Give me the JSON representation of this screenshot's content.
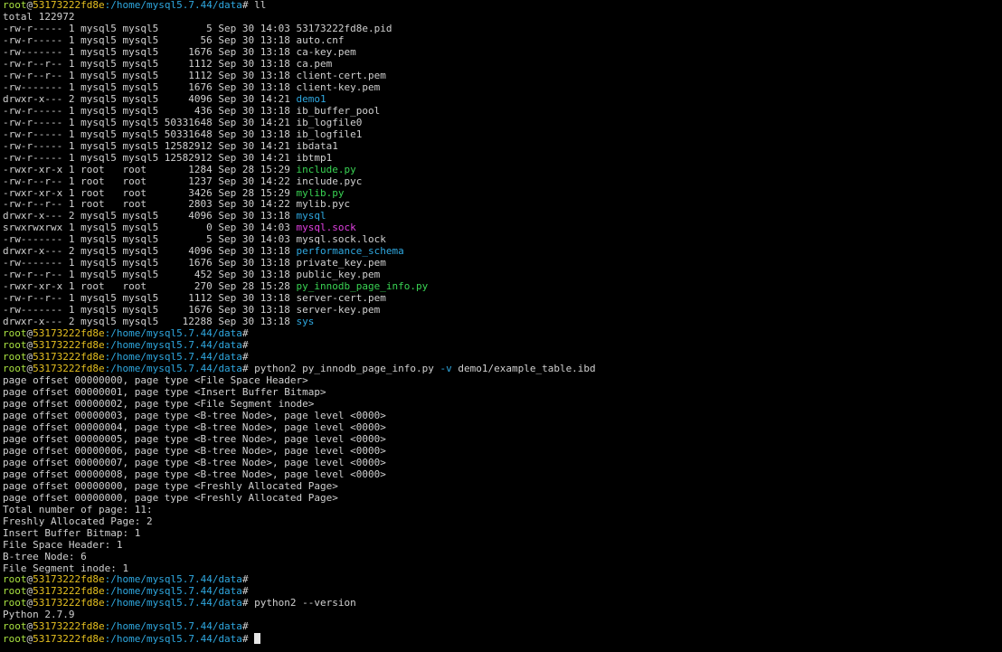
{
  "colors": {
    "background": "#000000",
    "default": "#d0d0d0",
    "prompt_user": "#a8e040",
    "prompt_at": "#d0d0d0",
    "prompt_host": "#e5c020",
    "prompt_path": "#2fa8e0",
    "directory": "#2fa8e0",
    "executable": "#39d353",
    "socket": "#e040e0",
    "option": "#2fa8e0",
    "cursor": "#e6e6e6"
  },
  "terminal": {
    "lines": [
      [
        {
          "t": "root",
          "c": "prompt_user"
        },
        {
          "t": "@",
          "c": "prompt_at"
        },
        {
          "t": "53173222fd8e",
          "c": "prompt_host"
        },
        {
          "t": ":/home/mysql5.7.44/data",
          "c": "prompt_path"
        },
        {
          "t": "# ll",
          "c": "default"
        }
      ],
      [
        {
          "t": "total 122972",
          "c": "default"
        }
      ],
      [
        {
          "t": "-rw-r----- 1 mysql5 mysql5        5 Sep 30 14:03 53173222fd8e.pid",
          "c": "default"
        }
      ],
      [
        {
          "t": "-rw-r----- 1 mysql5 mysql5       56 Sep 30 13:18 auto.cnf",
          "c": "default"
        }
      ],
      [
        {
          "t": "-rw------- 1 mysql5 mysql5     1676 Sep 30 13:18 ca-key.pem",
          "c": "default"
        }
      ],
      [
        {
          "t": "-rw-r--r-- 1 mysql5 mysql5     1112 Sep 30 13:18 ca.pem",
          "c": "default"
        }
      ],
      [
        {
          "t": "-rw-r--r-- 1 mysql5 mysql5     1112 Sep 30 13:18 client-cert.pem",
          "c": "default"
        }
      ],
      [
        {
          "t": "-rw------- 1 mysql5 mysql5     1676 Sep 30 13:18 client-key.pem",
          "c": "default"
        }
      ],
      [
        {
          "t": "drwxr-x--- 2 mysql5 mysql5     4096 Sep 30 14:21 ",
          "c": "default"
        },
        {
          "t": "demo1",
          "c": "directory"
        }
      ],
      [
        {
          "t": "-rw-r----- 1 mysql5 mysql5      436 Sep 30 13:18 ib_buffer_pool",
          "c": "default"
        }
      ],
      [
        {
          "t": "-rw-r----- 1 mysql5 mysql5 50331648 Sep 30 14:21 ib_logfile0",
          "c": "default"
        }
      ],
      [
        {
          "t": "-rw-r----- 1 mysql5 mysql5 50331648 Sep 30 13:18 ib_logfile1",
          "c": "default"
        }
      ],
      [
        {
          "t": "-rw-r----- 1 mysql5 mysql5 12582912 Sep 30 14:21 ibdata1",
          "c": "default"
        }
      ],
      [
        {
          "t": "-rw-r----- 1 mysql5 mysql5 12582912 Sep 30 14:21 ibtmp1",
          "c": "default"
        }
      ],
      [
        {
          "t": "-rwxr-xr-x 1 root   root       1284 Sep 28 15:29 ",
          "c": "default"
        },
        {
          "t": "include.py",
          "c": "executable"
        }
      ],
      [
        {
          "t": "-rw-r--r-- 1 root   root       1237 Sep 30 14:22 include.pyc",
          "c": "default"
        }
      ],
      [
        {
          "t": "-rwxr-xr-x 1 root   root       3426 Sep 28 15:29 ",
          "c": "default"
        },
        {
          "t": "mylib.py",
          "c": "executable"
        }
      ],
      [
        {
          "t": "-rw-r--r-- 1 root   root       2803 Sep 30 14:22 mylib.pyc",
          "c": "default"
        }
      ],
      [
        {
          "t": "drwxr-x--- 2 mysql5 mysql5     4096 Sep 30 13:18 ",
          "c": "default"
        },
        {
          "t": "mysql",
          "c": "directory"
        }
      ],
      [
        {
          "t": "srwxrwxrwx 1 mysql5 mysql5        0 Sep 30 14:03 ",
          "c": "default"
        },
        {
          "t": "mysql.sock",
          "c": "socket"
        }
      ],
      [
        {
          "t": "-rw------- 1 mysql5 mysql5        5 Sep 30 14:03 mysql.sock.lock",
          "c": "default"
        }
      ],
      [
        {
          "t": "drwxr-x--- 2 mysql5 mysql5     4096 Sep 30 13:18 ",
          "c": "default"
        },
        {
          "t": "performance_schema",
          "c": "directory"
        }
      ],
      [
        {
          "t": "-rw------- 1 mysql5 mysql5     1676 Sep 30 13:18 private_key.pem",
          "c": "default"
        }
      ],
      [
        {
          "t": "-rw-r--r-- 1 mysql5 mysql5      452 Sep 30 13:18 public_key.pem",
          "c": "default"
        }
      ],
      [
        {
          "t": "-rwxr-xr-x 1 root   root        270 Sep 28 15:28 ",
          "c": "default"
        },
        {
          "t": "py_innodb_page_info.py",
          "c": "executable"
        }
      ],
      [
        {
          "t": "-rw-r--r-- 1 mysql5 mysql5     1112 Sep 30 13:18 server-cert.pem",
          "c": "default"
        }
      ],
      [
        {
          "t": "-rw------- 1 mysql5 mysql5     1676 Sep 30 13:18 server-key.pem",
          "c": "default"
        }
      ],
      [
        {
          "t": "drwxr-x--- 2 mysql5 mysql5    12288 Sep 30 13:18 ",
          "c": "default"
        },
        {
          "t": "sys",
          "c": "directory"
        }
      ],
      [
        {
          "t": "root",
          "c": "prompt_user"
        },
        {
          "t": "@",
          "c": "prompt_at"
        },
        {
          "t": "53173222fd8e",
          "c": "prompt_host"
        },
        {
          "t": ":/home/mysql5.7.44/data",
          "c": "prompt_path"
        },
        {
          "t": "#",
          "c": "default"
        }
      ],
      [
        {
          "t": "root",
          "c": "prompt_user"
        },
        {
          "t": "@",
          "c": "prompt_at"
        },
        {
          "t": "53173222fd8e",
          "c": "prompt_host"
        },
        {
          "t": ":/home/mysql5.7.44/data",
          "c": "prompt_path"
        },
        {
          "t": "#",
          "c": "default"
        }
      ],
      [
        {
          "t": "root",
          "c": "prompt_user"
        },
        {
          "t": "@",
          "c": "prompt_at"
        },
        {
          "t": "53173222fd8e",
          "c": "prompt_host"
        },
        {
          "t": ":/home/mysql5.7.44/data",
          "c": "prompt_path"
        },
        {
          "t": "#",
          "c": "default"
        }
      ],
      [
        {
          "t": "root",
          "c": "prompt_user"
        },
        {
          "t": "@",
          "c": "prompt_at"
        },
        {
          "t": "53173222fd8e",
          "c": "prompt_host"
        },
        {
          "t": ":/home/mysql5.7.44/data",
          "c": "prompt_path"
        },
        {
          "t": "# python2 py_innodb_page_info.py ",
          "c": "default"
        },
        {
          "t": "-v",
          "c": "option"
        },
        {
          "t": " demo1/example_table.ibd",
          "c": "default"
        }
      ],
      [
        {
          "t": "page offset 00000000, page type <File Space Header>",
          "c": "default"
        }
      ],
      [
        {
          "t": "page offset 00000001, page type <Insert Buffer Bitmap>",
          "c": "default"
        }
      ],
      [
        {
          "t": "page offset 00000002, page type <File Segment inode>",
          "c": "default"
        }
      ],
      [
        {
          "t": "page offset 00000003, page type <B-tree Node>, page level <0000>",
          "c": "default"
        }
      ],
      [
        {
          "t": "page offset 00000004, page type <B-tree Node>, page level <0000>",
          "c": "default"
        }
      ],
      [
        {
          "t": "page offset 00000005, page type <B-tree Node>, page level <0000>",
          "c": "default"
        }
      ],
      [
        {
          "t": "page offset 00000006, page type <B-tree Node>, page level <0000>",
          "c": "default"
        }
      ],
      [
        {
          "t": "page offset 00000007, page type <B-tree Node>, page level <0000>",
          "c": "default"
        }
      ],
      [
        {
          "t": "page offset 00000008, page type <B-tree Node>, page level <0000>",
          "c": "default"
        }
      ],
      [
        {
          "t": "page offset 00000000, page type <Freshly Allocated Page>",
          "c": "default"
        }
      ],
      [
        {
          "t": "page offset 00000000, page type <Freshly Allocated Page>",
          "c": "default"
        }
      ],
      [
        {
          "t": "Total number of page: 11:",
          "c": "default"
        }
      ],
      [
        {
          "t": "Freshly Allocated Page: 2",
          "c": "default"
        }
      ],
      [
        {
          "t": "Insert Buffer Bitmap: 1",
          "c": "default"
        }
      ],
      [
        {
          "t": "File Space Header: 1",
          "c": "default"
        }
      ],
      [
        {
          "t": "B-tree Node: 6",
          "c": "default"
        }
      ],
      [
        {
          "t": "File Segment inode: 1",
          "c": "default"
        }
      ],
      [
        {
          "t": "root",
          "c": "prompt_user"
        },
        {
          "t": "@",
          "c": "prompt_at"
        },
        {
          "t": "53173222fd8e",
          "c": "prompt_host"
        },
        {
          "t": ":/home/mysql5.7.44/data",
          "c": "prompt_path"
        },
        {
          "t": "#",
          "c": "default"
        }
      ],
      [
        {
          "t": "root",
          "c": "prompt_user"
        },
        {
          "t": "@",
          "c": "prompt_at"
        },
        {
          "t": "53173222fd8e",
          "c": "prompt_host"
        },
        {
          "t": ":/home/mysql5.7.44/data",
          "c": "prompt_path"
        },
        {
          "t": "#",
          "c": "default"
        }
      ],
      [
        {
          "t": "root",
          "c": "prompt_user"
        },
        {
          "t": "@",
          "c": "prompt_at"
        },
        {
          "t": "53173222fd8e",
          "c": "prompt_host"
        },
        {
          "t": ":/home/mysql5.7.44/data",
          "c": "prompt_path"
        },
        {
          "t": "# python2 --version",
          "c": "default"
        }
      ],
      [
        {
          "t": "Python 2.7.9",
          "c": "default"
        }
      ],
      [
        {
          "t": "root",
          "c": "prompt_user"
        },
        {
          "t": "@",
          "c": "prompt_at"
        },
        {
          "t": "53173222fd8e",
          "c": "prompt_host"
        },
        {
          "t": ":/home/mysql5.7.44/data",
          "c": "prompt_path"
        },
        {
          "t": "#",
          "c": "default"
        }
      ],
      [
        {
          "t": "root",
          "c": "prompt_user"
        },
        {
          "t": "@",
          "c": "prompt_at"
        },
        {
          "t": "53173222fd8e",
          "c": "prompt_host"
        },
        {
          "t": ":/home/mysql5.7.44/data",
          "c": "prompt_path"
        },
        {
          "t": "# ",
          "c": "default"
        },
        {
          "cursor": true
        }
      ]
    ]
  }
}
